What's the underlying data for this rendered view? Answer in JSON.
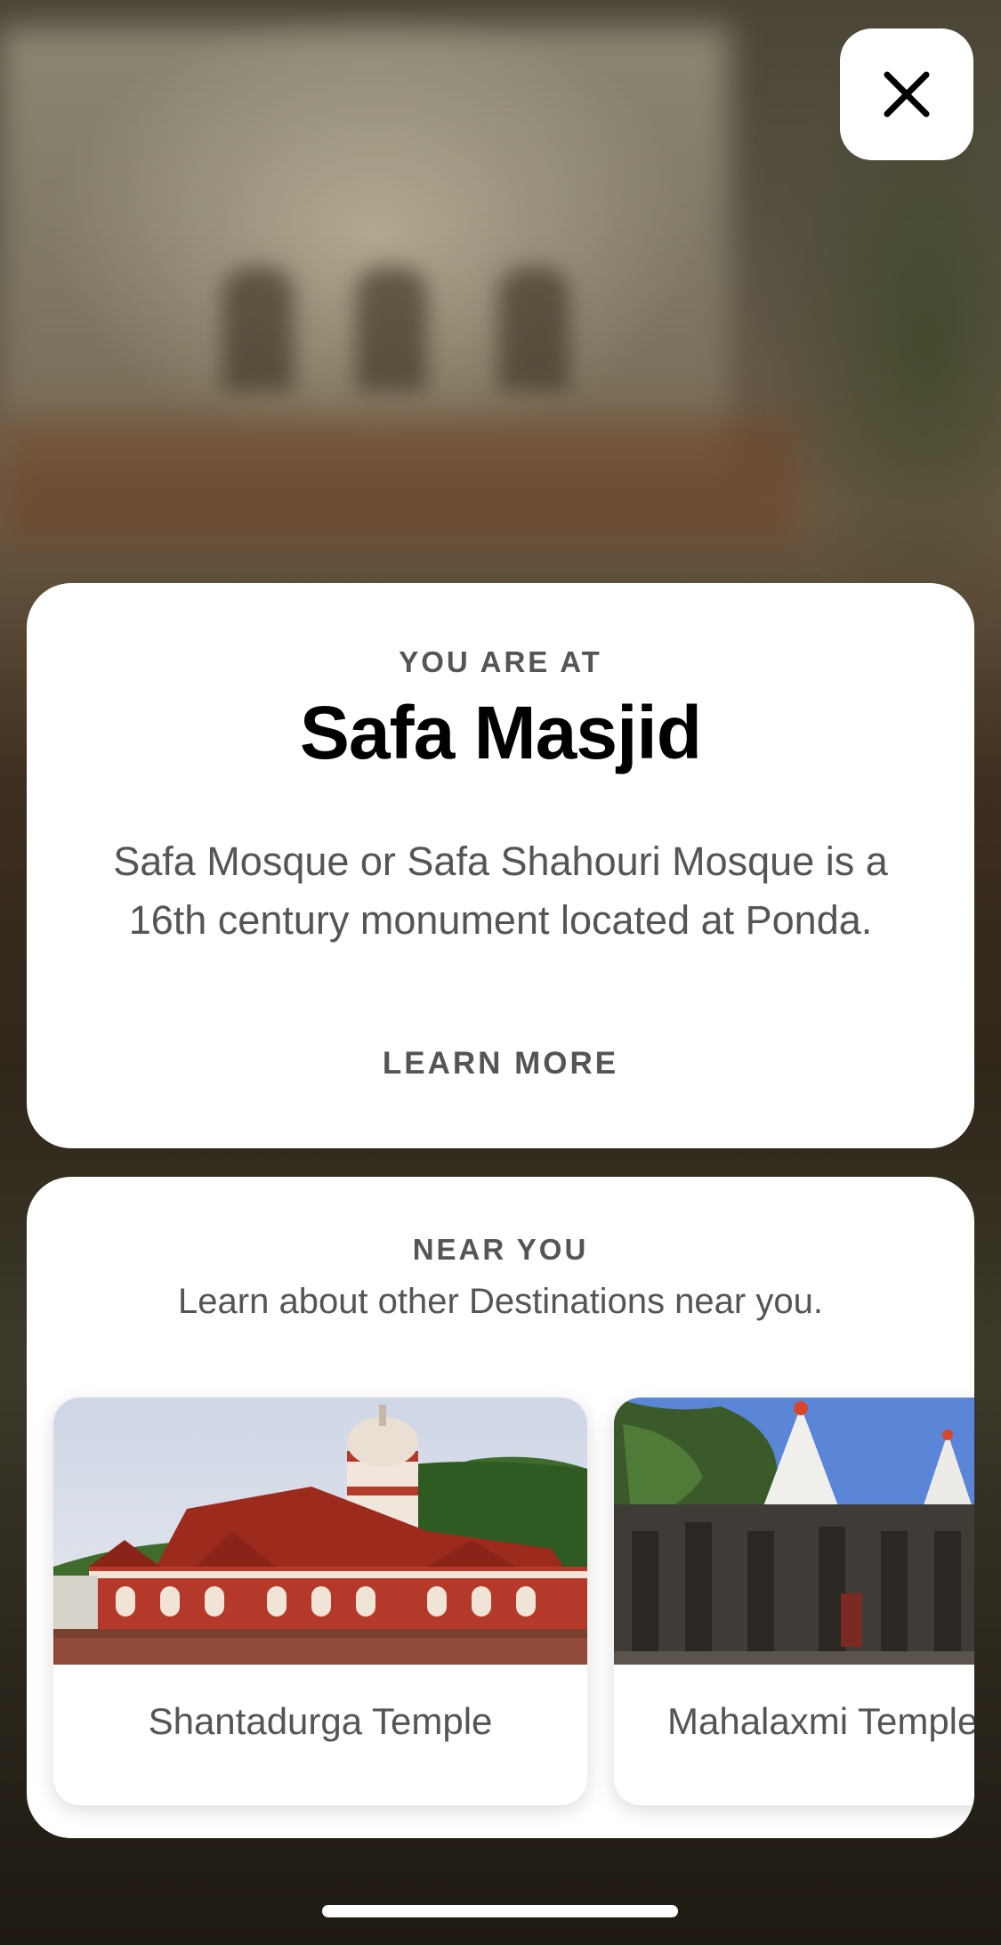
{
  "close_button": {
    "icon": "close-icon"
  },
  "location": {
    "eyebrow": "YOU ARE AT",
    "title": "Safa Masjid",
    "description": "Safa Mosque or Safa Shahouri Mosque is a 16th century monument located at Ponda.",
    "learn_more": "LEARN MORE"
  },
  "nearby": {
    "eyebrow": "NEAR YOU",
    "subtitle": "Learn about other Destinations near you.",
    "destinations": [
      {
        "name": "Shantadurga Temple"
      },
      {
        "name": "Mahalaxmi Temple"
      }
    ]
  },
  "colors": {
    "card_bg": "#ffffff",
    "title_text": "#000000",
    "muted_text": "#555555"
  }
}
